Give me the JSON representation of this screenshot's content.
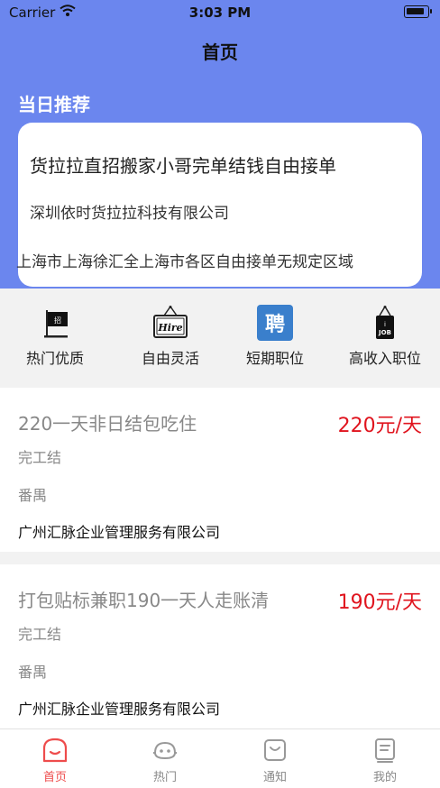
{
  "status_bar": {
    "carrier": "Carrier",
    "time": "3:03 PM"
  },
  "header": {
    "title": "首页"
  },
  "recommend": {
    "section_title": "当日推荐",
    "title": "货拉拉直招搬家小哥完单结钱自由接单",
    "company": "深圳依时货拉拉科技有限公司",
    "area": "上海市上海徐汇全上海市各区自由接单无规定区域"
  },
  "categories": [
    {
      "label": "热门优质",
      "icon": "flag-icon"
    },
    {
      "label": "自由灵活",
      "icon": "hire-sign-icon"
    },
    {
      "label": "短期职位",
      "icon": "pin-badge-icon"
    },
    {
      "label": "高收入职位",
      "icon": "job-sign-icon"
    }
  ],
  "jobs": [
    {
      "title": "220一天非日结包吃住",
      "pay": "220元/天",
      "settle": "完工结",
      "district": "番禺",
      "company": "广州汇脉企业管理服务有限公司"
    },
    {
      "title": "打包贴标兼职190一天人走账清",
      "pay": "190元/天",
      "settle": "完工结",
      "district": "番禺",
      "company": "广州汇脉企业管理服务有限公司"
    }
  ],
  "tabbar": {
    "active": 0,
    "items": [
      {
        "label": "首页",
        "icon": "home-icon"
      },
      {
        "label": "热门",
        "icon": "hot-icon"
      },
      {
        "label": "通知",
        "icon": "notice-icon"
      },
      {
        "label": "我的",
        "icon": "profile-icon"
      }
    ]
  },
  "colors": {
    "header_bg": "#6b86ee",
    "price": "#e0141e",
    "tab_active": "#ee4c4c",
    "tab_inactive": "#888888"
  }
}
